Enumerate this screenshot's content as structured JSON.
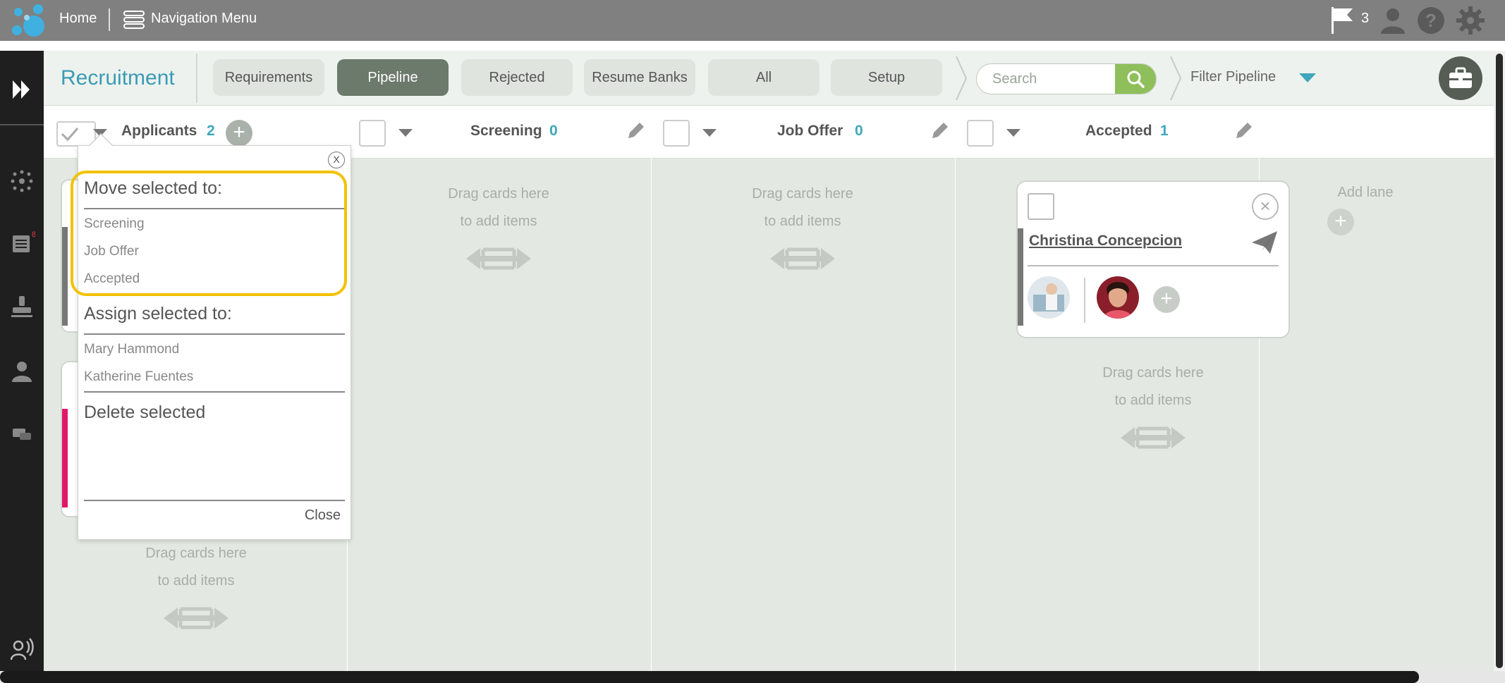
{
  "topbar": {
    "home_label": "Home",
    "nav_label": "Navigation Menu",
    "flag_count": "3",
    "icons": [
      "logo-icon",
      "menu-icon",
      "flag-icon",
      "user-icon",
      "help-icon",
      "gear-icon"
    ]
  },
  "rail": {
    "icons": [
      "expand-icon",
      "network-icon",
      "list-icon",
      "stamp-icon",
      "person-icon",
      "chat-icon",
      "broadcast-icon"
    ],
    "badge": "8"
  },
  "header": {
    "title": "Recruitment",
    "tabs": [
      {
        "label": "Requirements",
        "active": false
      },
      {
        "label": "Pipeline",
        "active": true
      },
      {
        "label": "Rejected",
        "active": false
      },
      {
        "label": "Resume Banks",
        "active": false
      },
      {
        "label": "All",
        "active": false
      },
      {
        "label": "Setup",
        "active": false
      }
    ],
    "search_placeholder": "Search",
    "filter_label": "Filter Pipeline",
    "accent": "#3a9bb5",
    "search_accent": "#8fbf5a"
  },
  "lanes": [
    {
      "title": "Applicants",
      "count": "2"
    },
    {
      "title": "Screening",
      "count": "0"
    },
    {
      "title": "Job Offer",
      "count": "0"
    },
    {
      "title": "Accepted",
      "count": "1"
    }
  ],
  "dropzone": {
    "line1": "Drag cards here",
    "line2": "to add items"
  },
  "add_lane": "Add lane",
  "card": {
    "name": "Christina Concepcion"
  },
  "popup": {
    "move_heading": "Move selected to:",
    "move_items": [
      "Screening",
      "Job Offer",
      "Accepted"
    ],
    "assign_heading": "Assign selected to:",
    "assign_items": [
      "Mary Hammond",
      "Katherine Fuentes"
    ],
    "delete_label": "Delete selected",
    "close_label": "Close",
    "x_label": "X",
    "highlight_color": "#f2c200"
  }
}
